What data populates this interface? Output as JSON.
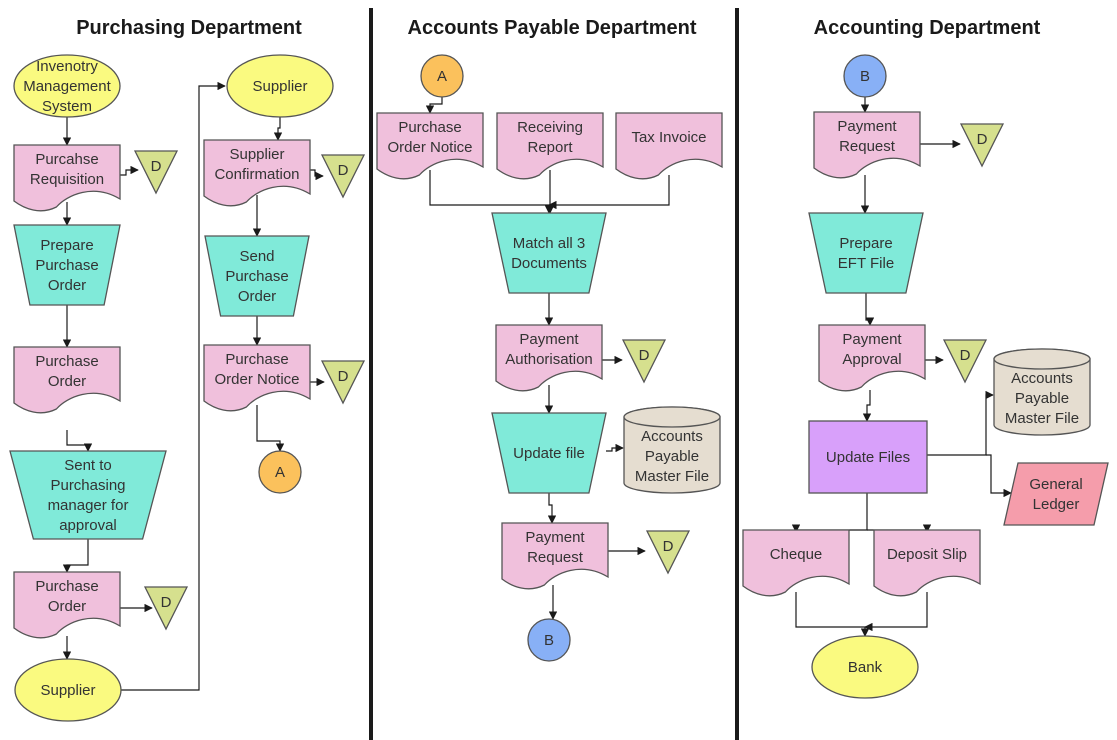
{
  "diagram_type": "cross-functional flowchart",
  "colors": {
    "terminator": "#FAFA80",
    "document": "#F0C0DC",
    "manual_operation": "#80EAD9",
    "offline_storage": "#D6E08E",
    "connector_a": "#FBC15C",
    "connector_b": "#88B0F6",
    "database": "#E5DDD0",
    "process": "#D8A0FA",
    "data_io": "#F59DAB",
    "divider": "#1a1a1a"
  },
  "lanes": [
    {
      "id": "purchasing",
      "title": "Purchasing Department"
    },
    {
      "id": "ap",
      "title": "Accounts Payable Department"
    },
    {
      "id": "accounting",
      "title": "Accounting Department"
    }
  ],
  "nodes": {
    "p_ims": {
      "type": "terminator",
      "lines": [
        "Invenotry",
        "Management",
        "System"
      ]
    },
    "p_req": {
      "type": "document",
      "lines": [
        "Purcahse",
        "Requisition"
      ]
    },
    "p_req_d": {
      "type": "offline_storage",
      "lines": [
        "D"
      ]
    },
    "p_prep": {
      "type": "manual_operation",
      "lines": [
        "Prepare",
        "Purchase",
        "Order"
      ]
    },
    "p_po1": {
      "type": "document",
      "lines": [
        "Purchase",
        "Order"
      ]
    },
    "p_sent": {
      "type": "manual_operation",
      "lines": [
        "Sent to",
        "Purchasing",
        "manager for",
        "approval"
      ]
    },
    "p_po2": {
      "type": "document",
      "lines": [
        "Purchase",
        "Order"
      ]
    },
    "p_po2_d": {
      "type": "offline_storage",
      "lines": [
        "D"
      ]
    },
    "p_sup1": {
      "type": "terminator",
      "lines": [
        "Supplier"
      ]
    },
    "p_sup2": {
      "type": "terminator",
      "lines": [
        "Supplier"
      ]
    },
    "p_conf": {
      "type": "document",
      "lines": [
        "Supplier",
        "Confirmation"
      ]
    },
    "p_conf_d": {
      "type": "offline_storage",
      "lines": [
        "D"
      ]
    },
    "p_send": {
      "type": "manual_operation",
      "lines": [
        "Send",
        "Purchase",
        "Order"
      ]
    },
    "p_pon": {
      "type": "document",
      "lines": [
        "Purchase",
        "Order Notice"
      ]
    },
    "p_pon_d": {
      "type": "offline_storage",
      "lines": [
        "D"
      ]
    },
    "p_a": {
      "type": "connector_a",
      "lines": [
        "A"
      ]
    },
    "a_a": {
      "type": "connector_a",
      "lines": [
        "A"
      ]
    },
    "a_pon": {
      "type": "document",
      "lines": [
        "Purchase",
        "Order Notice"
      ]
    },
    "a_rr": {
      "type": "document",
      "lines": [
        "Receiving",
        "Report"
      ]
    },
    "a_tax": {
      "type": "document",
      "lines": [
        "Tax Invoice"
      ]
    },
    "a_match": {
      "type": "manual_operation",
      "lines": [
        "Match all 3",
        "Documents"
      ]
    },
    "a_auth": {
      "type": "document",
      "lines": [
        "Payment",
        "Authorisation"
      ]
    },
    "a_auth_d": {
      "type": "offline_storage",
      "lines": [
        "D"
      ]
    },
    "a_upd": {
      "type": "manual_operation",
      "lines": [
        "Update file"
      ]
    },
    "a_db": {
      "type": "database",
      "lines": [
        "Accounts",
        "Payable",
        "Master File"
      ]
    },
    "a_req": {
      "type": "document",
      "lines": [
        "Payment",
        "Request"
      ]
    },
    "a_req_d": {
      "type": "offline_storage",
      "lines": [
        "D"
      ]
    },
    "a_b": {
      "type": "connector_b",
      "lines": [
        "B"
      ]
    },
    "c_b": {
      "type": "connector_b",
      "lines": [
        "B"
      ]
    },
    "c_req": {
      "type": "document",
      "lines": [
        "Payment",
        "Request"
      ]
    },
    "c_req_d": {
      "type": "offline_storage",
      "lines": [
        "D"
      ]
    },
    "c_eft": {
      "type": "manual_operation",
      "lines": [
        "Prepare",
        "EFT File"
      ]
    },
    "c_appr": {
      "type": "document",
      "lines": [
        "Payment",
        "Approval"
      ]
    },
    "c_appr_d": {
      "type": "offline_storage",
      "lines": [
        "D"
      ]
    },
    "c_upd": {
      "type": "process",
      "lines": [
        "Update Files"
      ]
    },
    "c_db": {
      "type": "database",
      "lines": [
        "Accounts",
        "Payable",
        "Master File"
      ]
    },
    "c_gl": {
      "type": "data_io",
      "lines": [
        "General",
        "Ledger"
      ]
    },
    "c_chq": {
      "type": "document",
      "lines": [
        "Cheque"
      ]
    },
    "c_dep": {
      "type": "document",
      "lines": [
        "Deposit Slip"
      ]
    },
    "c_bank": {
      "type": "terminator",
      "lines": [
        "Bank"
      ]
    }
  },
  "edges": [
    {
      "from": "p_ims",
      "to": "p_req"
    },
    {
      "from": "p_req",
      "to": "p_req_d"
    },
    {
      "from": "p_req",
      "to": "p_prep"
    },
    {
      "from": "p_prep",
      "to": "p_po1"
    },
    {
      "from": "p_po1",
      "to": "p_sent"
    },
    {
      "from": "p_sent",
      "to": "p_po2"
    },
    {
      "from": "p_po2",
      "to": "p_po2_d"
    },
    {
      "from": "p_po2",
      "to": "p_sup1"
    },
    {
      "from": "p_sup1",
      "to": "p_sup2"
    },
    {
      "from": "p_sup2",
      "to": "p_conf"
    },
    {
      "from": "p_conf",
      "to": "p_conf_d"
    },
    {
      "from": "p_conf",
      "to": "p_send"
    },
    {
      "from": "p_send",
      "to": "p_pon"
    },
    {
      "from": "p_pon",
      "to": "p_pon_d"
    },
    {
      "from": "p_pon",
      "to": "p_a"
    },
    {
      "from": "a_a",
      "to": "a_pon"
    },
    {
      "from": "a_pon",
      "to": "a_match"
    },
    {
      "from": "a_rr",
      "to": "a_match"
    },
    {
      "from": "a_tax",
      "to": "a_match"
    },
    {
      "from": "a_match",
      "to": "a_auth"
    },
    {
      "from": "a_auth",
      "to": "a_auth_d"
    },
    {
      "from": "a_auth",
      "to": "a_upd"
    },
    {
      "from": "a_upd",
      "to": "a_db"
    },
    {
      "from": "a_upd",
      "to": "a_req"
    },
    {
      "from": "a_req",
      "to": "a_req_d"
    },
    {
      "from": "a_req",
      "to": "a_b"
    },
    {
      "from": "c_b",
      "to": "c_req"
    },
    {
      "from": "c_req",
      "to": "c_req_d"
    },
    {
      "from": "c_req",
      "to": "c_eft"
    },
    {
      "from": "c_eft",
      "to": "c_appr"
    },
    {
      "from": "c_appr",
      "to": "c_appr_d"
    },
    {
      "from": "c_appr",
      "to": "c_upd"
    },
    {
      "from": "c_upd",
      "to": "c_db"
    },
    {
      "from": "c_upd",
      "to": "c_gl"
    },
    {
      "from": "c_upd",
      "to": "c_chq"
    },
    {
      "from": "c_upd",
      "to": "c_dep"
    },
    {
      "from": "c_chq",
      "to": "c_bank"
    },
    {
      "from": "c_dep",
      "to": "c_bank"
    }
  ]
}
